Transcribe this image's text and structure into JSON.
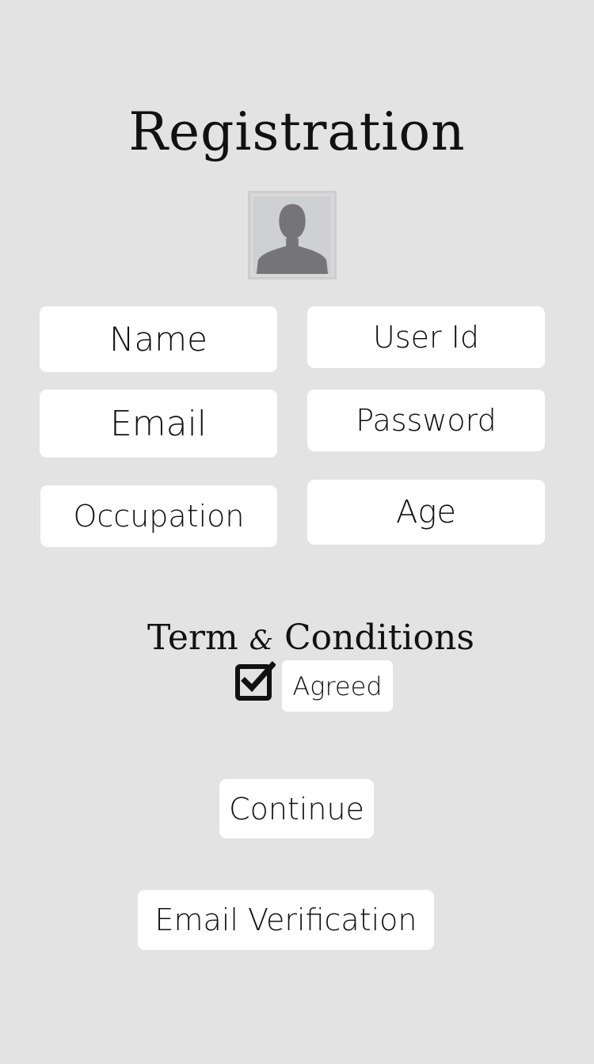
{
  "page": {
    "title": "Registration",
    "background_color": "#e3e3e3"
  },
  "avatar": {
    "icon": "user-silhouette-icon"
  },
  "fields": {
    "name": "Name",
    "user_id": "User Id",
    "email": "Email",
    "password": "Password",
    "occupation": "Occupation",
    "age": "Age"
  },
  "terms": {
    "term": "Term",
    "amp": "&",
    "conditions": "Conditions",
    "checkbox_checked": true,
    "checkbox_icon": "checkbox-checked-icon",
    "agreed_label": "Agreed"
  },
  "buttons": {
    "continue": "Continue",
    "email_verification": "Email Verification"
  }
}
